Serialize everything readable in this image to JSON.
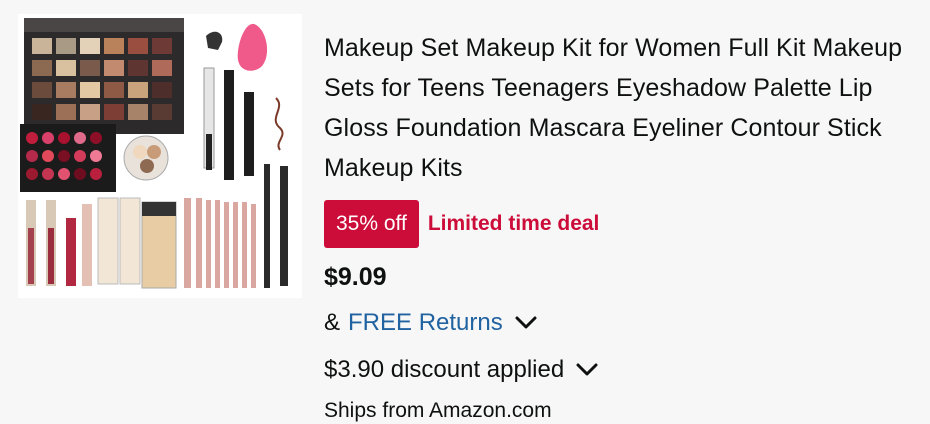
{
  "product": {
    "title": "Makeup Set Makeup Kit for Women Full Kit Makeup Sets for Teens Teenagers Eyeshadow Palette Lip Gloss Foundation Mascara Eyeliner Contour Stick Makeup Kits",
    "image_icon": "makeup-kit-product-image",
    "deal": {
      "badge": "35% off",
      "label": "Limited time deal"
    },
    "price": "$9.09",
    "returns": {
      "prefix": "&",
      "link": "FREE Returns"
    },
    "discount": "$3.90 discount applied",
    "ships_from": "Ships from Amazon.com"
  },
  "colors": {
    "deal": "#cc0c39",
    "link": "#2162a1",
    "background": "#f7f7f7"
  }
}
